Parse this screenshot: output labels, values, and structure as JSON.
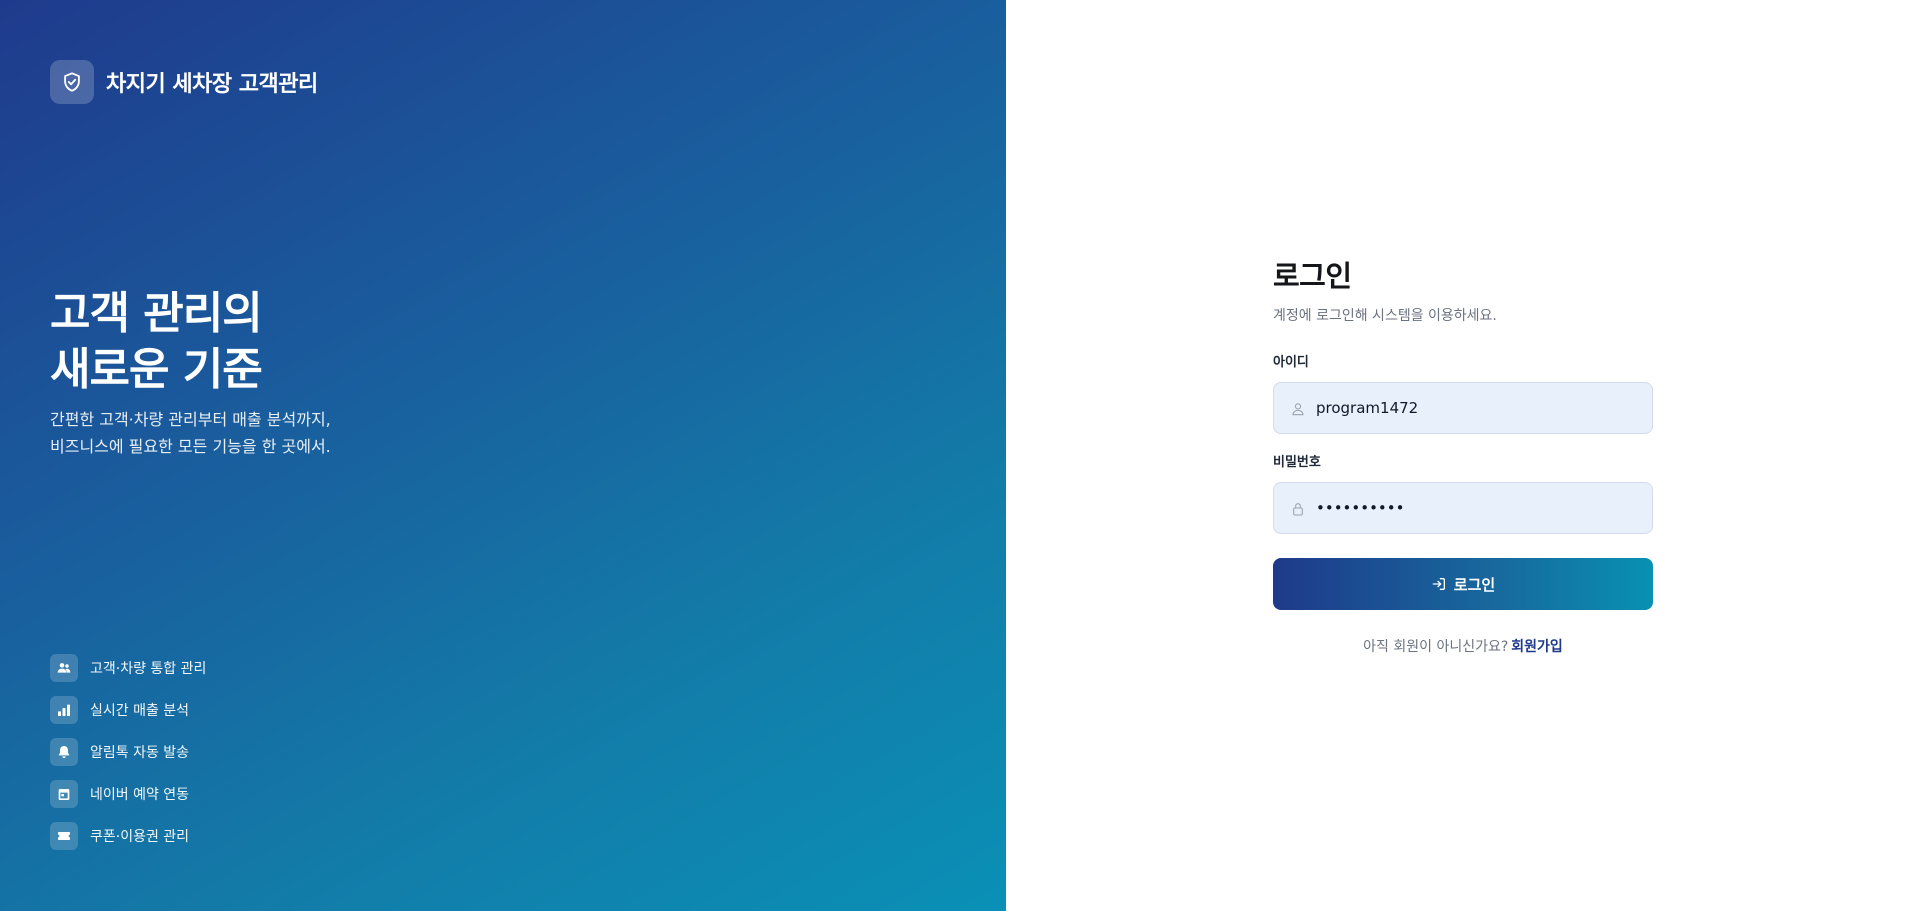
{
  "brand": {
    "name": "차지기 세차장 고객관리",
    "icon": "shield-check-icon"
  },
  "hero": {
    "headline_line1": "고객 관리의",
    "headline_line2": "새로운 기준",
    "subtext_line1": "간편한 고객·차량 관리부터 매출 분석까지,",
    "subtext_line2": "비즈니스에 필요한 모든 기능을 한 곳에서.",
    "features": [
      {
        "icon": "users-icon",
        "label": "고객·차량 통합 관리"
      },
      {
        "icon": "bar-chart-icon",
        "label": "실시간 매출 분석"
      },
      {
        "icon": "bell-icon",
        "label": "알림톡 자동 발송"
      },
      {
        "icon": "calendar-icon",
        "label": "네이버 예약 연동"
      },
      {
        "icon": "ticket-icon",
        "label": "쿠폰·이용권 관리"
      }
    ]
  },
  "login": {
    "title": "로그인",
    "subtitle": "계정에 로그인해 시스템을 이용하세요.",
    "id_label": "아이디",
    "id_value": "program1472",
    "password_label": "비밀번호",
    "password_value": "••••••••••",
    "button_label": "로그인",
    "signup_prompt": "아직 회원이 아니신가요?",
    "signup_link": "회원가입"
  },
  "colors": {
    "hero_gradient_start": "#1f3a8c",
    "hero_gradient_end": "#0a90b6",
    "input_background": "#e8f0fc",
    "link_color": "#1e3a8a"
  }
}
